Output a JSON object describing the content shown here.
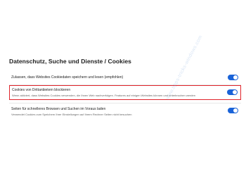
{
  "section": {
    "title": "Datenschutz, Suche und Dienste / Cookies"
  },
  "settings": [
    {
      "title": "Zulassen, dass Websites Cookiedaten speichern und lesen (empfohlen)",
      "description": "",
      "enabled": true
    },
    {
      "title": "Cookies von Drittanbietern blockieren",
      "description": "Wenn aktiviert, dass Websites Cookies verwenden, die Ihnen Web nachverfolgen. Features auf einigen Websites können und unterbrochen werden",
      "enabled": true,
      "highlighted": true
    },
    {
      "title": "Seiten für schnelleres Browsen und Suchen im Voraus laden",
      "description": "Verwendet Cookies zum Speichern Ihrer Einstellungen auf Ihrem Rechner Seiten nicht besuchen",
      "enabled": true
    }
  ],
  "watermark": {
    "text": "www.tipps-tricks-windows.com"
  },
  "colors": {
    "toggle_on": "#1a63d8",
    "highlight_border": "#e0242b"
  }
}
